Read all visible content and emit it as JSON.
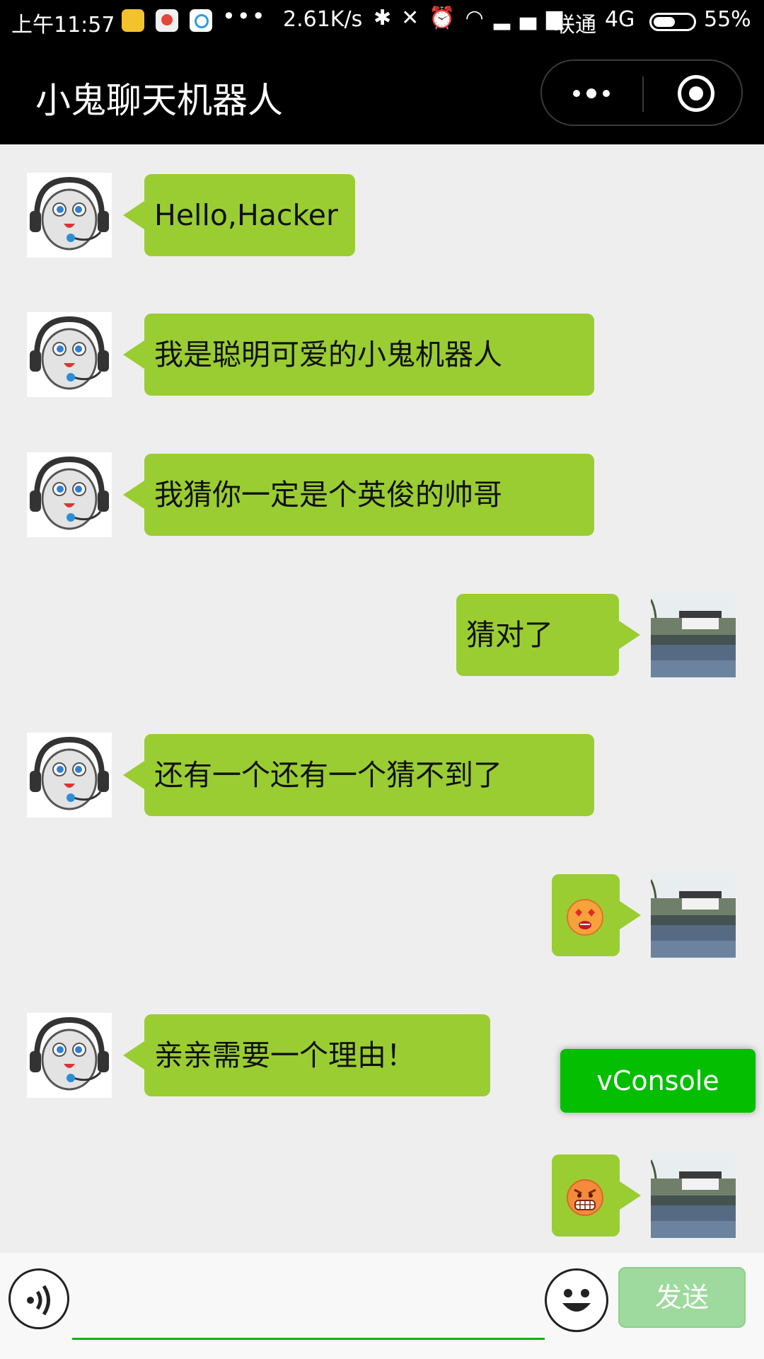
{
  "status_bar": {
    "time": "上午11:57",
    "app_icons": [
      "sohu-news-app-icon",
      "video-app-icon",
      "browser-app-icon"
    ],
    "more": "•••",
    "speed": "2.61K/s",
    "carrier": "联通",
    "network": "4G",
    "battery_level": 0.55,
    "battery": "55%"
  },
  "nav": {
    "title": "小鬼聊天机器人"
  },
  "messages": [
    {
      "from": "robot",
      "type": "text",
      "text": "Hello,Hacker"
    },
    {
      "from": "robot",
      "type": "text",
      "text": "我是聪明可爱的小鬼机器人"
    },
    {
      "from": "robot",
      "type": "text",
      "text": "我猜你一定是个英俊的帅哥"
    },
    {
      "from": "user",
      "type": "text",
      "text": "猜对了"
    },
    {
      "from": "robot",
      "type": "text",
      "text": "还有一个还有一个猜不到了"
    },
    {
      "from": "user",
      "type": "emoji",
      "emoji": "love-eyes-emoji-icon"
    },
    {
      "from": "robot",
      "type": "text",
      "text": "亲亲需要一个理由！"
    },
    {
      "from": "user",
      "type": "emoji",
      "emoji": "angry-grin-emoji-icon"
    }
  ],
  "vconsole": {
    "label": "vConsole"
  },
  "input": {
    "value": "",
    "placeholder": ""
  },
  "send": {
    "label": "发送"
  },
  "colors": {
    "bubble": "#9acd32",
    "background": "#eeeeee",
    "accent_green": "#04be02",
    "send_disabled": "#9ed99d"
  }
}
